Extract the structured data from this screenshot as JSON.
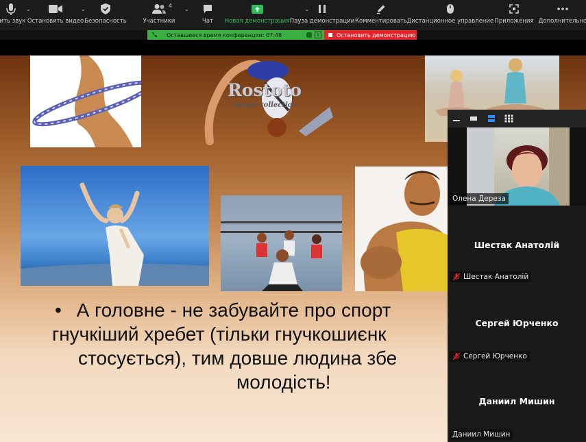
{
  "toolbar": {
    "items": [
      {
        "label": "вить звук",
        "icon": "mic-icon"
      },
      {
        "label": "Остановить видео",
        "icon": "video-camera-icon"
      },
      {
        "label": "Безопасность",
        "icon": "shield-icon"
      },
      {
        "label": "Участники",
        "icon": "participants-icon",
        "count": "4"
      },
      {
        "label": "Чат",
        "icon": "chat-icon"
      },
      {
        "label": "Новая демонстрация",
        "icon": "share-screen-icon"
      },
      {
        "label": "Пауза демонстрации",
        "icon": "pause-icon"
      },
      {
        "label": "Комментировать",
        "icon": "annotate-icon"
      },
      {
        "label": "Дистанционное управление",
        "icon": "remote-control-icon"
      },
      {
        "label": "Приложения",
        "icon": "apps-icon"
      },
      {
        "label": "Дополнительно",
        "icon": "more-icon"
      }
    ]
  },
  "share_bar": {
    "status": "Оставшееся время конференции: 07:48",
    "stop_label": "Остановить демонстрацию"
  },
  "slide": {
    "logo_text_1": "Rostoto",
    "logo_text_2": "Image collection",
    "bullet": "•",
    "lines": [
      "А головне - не забувайте про спорт",
      "гнучкіший хребет (тільки гнучкошиєнк",
      "стосується), тим довше людина збе",
      "молодість!"
    ]
  },
  "participants": {
    "tiles": [
      {
        "name": "Олена Дереза",
        "has_video": true
      },
      {
        "name": "Шестак Анатолій",
        "label": "Шестак Анатолій",
        "muted": true
      },
      {
        "name": "Сергей Юрченко",
        "label": "Сергей Юрченко",
        "muted": true
      },
      {
        "name": "Даниил Мишин",
        "label": "Даниил Мишин",
        "muted": false
      }
    ]
  },
  "colors": {
    "accent_green": "#2ebd5a",
    "stop_red": "#e2262b",
    "toolbar_bg": "#1c1c1c",
    "active_blue": "#2d8cff"
  }
}
